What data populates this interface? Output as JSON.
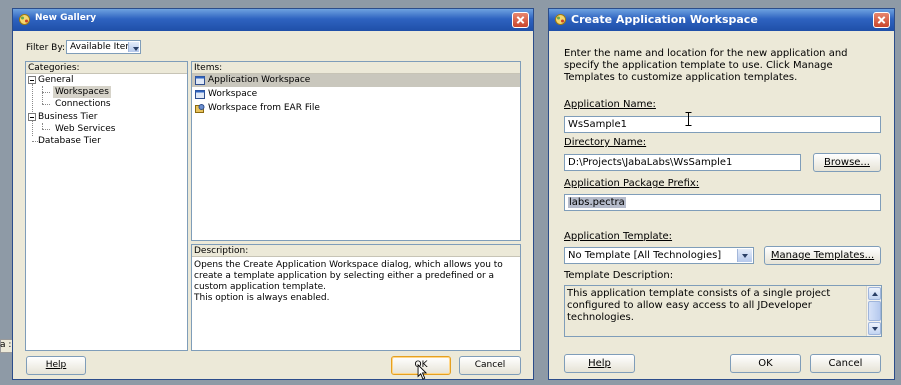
{
  "new_gallery": {
    "title": "New Gallery",
    "filter_label": "Filter By:",
    "filter_value": "Available Items",
    "categories_header": "Categories:",
    "categories": {
      "general": "General",
      "workspaces": "Workspaces",
      "connections": "Connections",
      "business_tier": "Business Tier",
      "web_services": "Web Services",
      "database_tier": "Database Tier"
    },
    "items_header": "Items:",
    "items": [
      {
        "label": "Application Workspace"
      },
      {
        "label": "Workspace"
      },
      {
        "label": "Workspace from EAR File"
      }
    ],
    "description_header": "Description:",
    "description_text": "Opens the Create Application Workspace dialog, which allows you to create a template application by selecting either a predefined or a custom application template.",
    "description_note": "This option is always enabled.",
    "help_label": "Help",
    "ok_label": "OK",
    "cancel_label": "Cancel"
  },
  "create_workspace": {
    "title": "Create Application Workspace",
    "intro": "Enter the name and location for the new application and specify the application template to use. Click Manage Templates to customize application templates.",
    "app_name_label": "Application Name:",
    "app_name_value": "WsSample1",
    "dir_name_label": "Directory Name:",
    "dir_name_value": "D:\\Projects\\JabaLabs\\WsSample1",
    "browse_label": "Browse...",
    "package_label": "Application Package Prefix:",
    "package_value": "labs.pectra",
    "template_label": "Application Template:",
    "template_value": "No Template [All Technologies]",
    "manage_label": "Manage Templates...",
    "template_desc_label": "Template Description:",
    "template_desc_text": "This application template consists of a single project configured to allow easy access to all JDeveloper technologies.",
    "help_label": "Help",
    "ok_label": "OK",
    "cancel_label": "Cancel"
  },
  "background": {
    "edge_fragment": "a :"
  },
  "colors": {
    "titlebar": "#2e63c0",
    "dialog_bg": "#ece9d8",
    "close_button": "#c8452c",
    "desktop": "#8e9aa6"
  }
}
